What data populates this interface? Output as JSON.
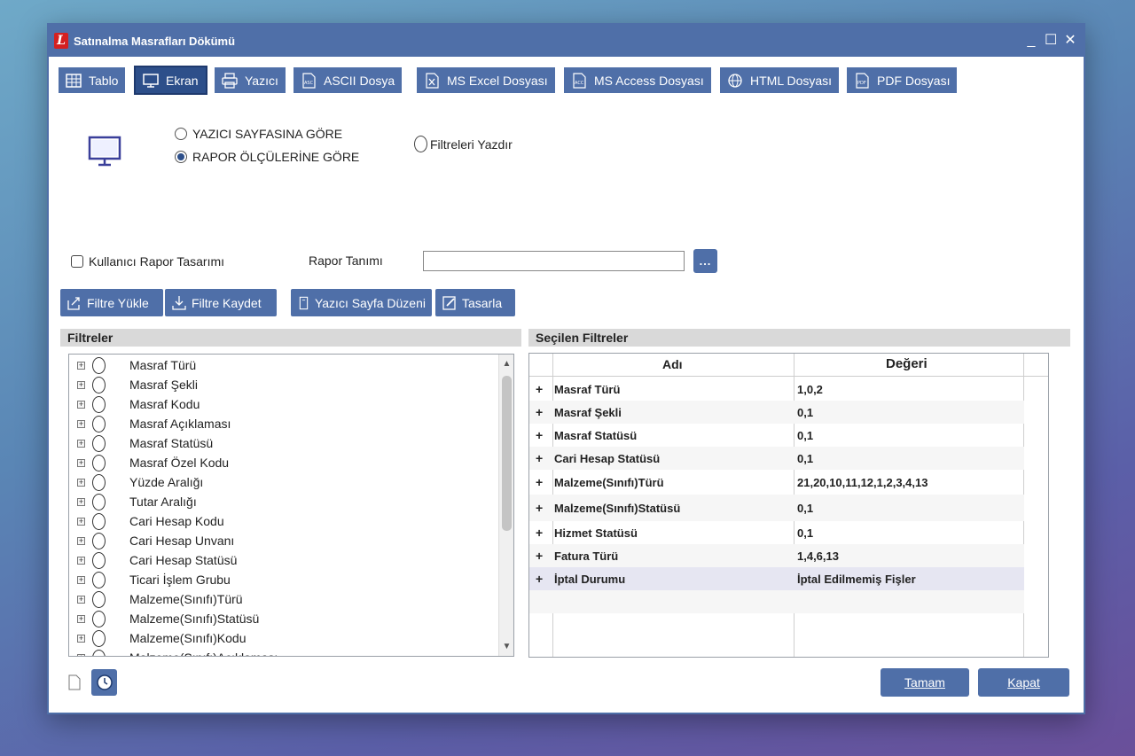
{
  "window": {
    "title": "Satınalma Masrafları Dökümü",
    "controls": [
      "_",
      "☐",
      "✕"
    ]
  },
  "toolbar": {
    "tabs": [
      {
        "label": "Tablo",
        "icon": "table-icon"
      },
      {
        "label": "Ekran",
        "icon": "monitor-icon",
        "active": true
      },
      {
        "label": "Yazıcı",
        "icon": "printer-icon"
      },
      {
        "label": "ASCII Dosya",
        "icon": "ascii-file-icon"
      },
      {
        "label": "MS Excel Dosyası",
        "icon": "excel-file-icon"
      },
      {
        "label": "MS Access Dosyası",
        "icon": "access-file-icon"
      },
      {
        "label": "HTML Dosyası",
        "icon": "html-file-icon"
      },
      {
        "label": "PDF Dosyası",
        "icon": "pdf-file-icon"
      }
    ]
  },
  "options": {
    "radio_printer_page": "YAZICI SAYFASINA GÖRE",
    "radio_report_size": "RAPOR ÖLÇÜLERİNE GÖRE",
    "selected": "report_size",
    "print_filters": "Filtreleri Yazdır",
    "user_report_design": "Kullanıcı Rapor Tasarımı",
    "report_definition_label": "Rapor Tanımı",
    "report_definition_value": "",
    "ellipsis": "..."
  },
  "actions": {
    "load_filter": "Filtre Yükle",
    "save_filter": "Filtre Kaydet",
    "page_setup": "Yazıcı Sayfa Düzeni",
    "design": "Tasarla"
  },
  "filters": {
    "header": "Filtreler",
    "items": [
      "Masraf Türü",
      "Masraf Şekli",
      "Masraf Kodu",
      "Masraf Açıklaması",
      "Masraf Statüsü",
      "Masraf Özel Kodu",
      "Yüzde Aralığı",
      "Tutar Aralığı",
      "Cari Hesap Kodu",
      "Cari Hesap Unvanı",
      "Cari Hesap Statüsü",
      "Ticari İşlem Grubu",
      "Malzeme(Sınıfı)Türü",
      "Malzeme(Sınıfı)Statüsü",
      "Malzeme(Sınıfı)Kodu",
      "Malzeme(Sınıfı)Açıklaması"
    ]
  },
  "selected_filters": {
    "header": "Seçilen Filtreler",
    "col_name": "Adı",
    "col_value": "Değeri",
    "rows": [
      {
        "name": "Masraf Türü",
        "value": "1,0,2"
      },
      {
        "name": "Masraf Şekli",
        "value": "0,1"
      },
      {
        "name": "Masraf Statüsü",
        "value": "0,1"
      },
      {
        "name": "Cari Hesap Statüsü",
        "value": "0,1"
      },
      {
        "name": "Malzeme(Sınıfı)Türü",
        "value": "21,20,10,11,12,1,2,3,4,13"
      },
      {
        "name": "Malzeme(Sınıfı)Statüsü",
        "value": "0,1"
      },
      {
        "name": "Hizmet Statüsü",
        "value": "0,1"
      },
      {
        "name": "Fatura Türü",
        "value": "1,4,6,13"
      },
      {
        "name": "İptal Durumu",
        "value": "İptal Edilmemiş Fişler"
      }
    ]
  },
  "footer": {
    "ok": "Tamam",
    "close": "Kapat"
  },
  "colors": {
    "accent": "#4f6fa8",
    "active_tab": "#2d4f8a",
    "highlight_row": "#e6e6f2"
  }
}
